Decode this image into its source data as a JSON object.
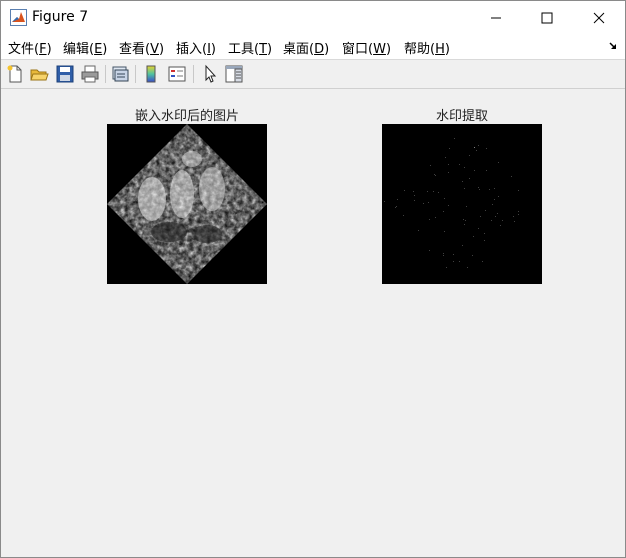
{
  "window": {
    "title": "Figure 7"
  },
  "menubar": {
    "items": [
      {
        "label": "文件(",
        "key": "F",
        "suffix": ")"
      },
      {
        "label": "编辑(",
        "key": "E",
        "suffix": ")"
      },
      {
        "label": "查看(",
        "key": "V",
        "suffix": ")"
      },
      {
        "label": "插入(",
        "key": "I",
        "suffix": ")"
      },
      {
        "label": "工具(",
        "key": "T",
        "suffix": ")"
      },
      {
        "label": "桌面(",
        "key": "D",
        "suffix": ")"
      },
      {
        "label": "窗口(",
        "key": "W",
        "suffix": ")"
      },
      {
        "label": "帮助(",
        "key": "H",
        "suffix": ")"
      }
    ]
  },
  "toolbar": {
    "icons": [
      "new-file-icon",
      "open-folder-icon",
      "save-icon",
      "print-icon",
      "link-figure-icon",
      "colorbar-icon",
      "legend-icon",
      "pointer-icon",
      "property-editor-icon"
    ]
  },
  "figure": {
    "left_axes_title": "嵌入水印后的图片",
    "right_axes_title": "水印提取"
  }
}
